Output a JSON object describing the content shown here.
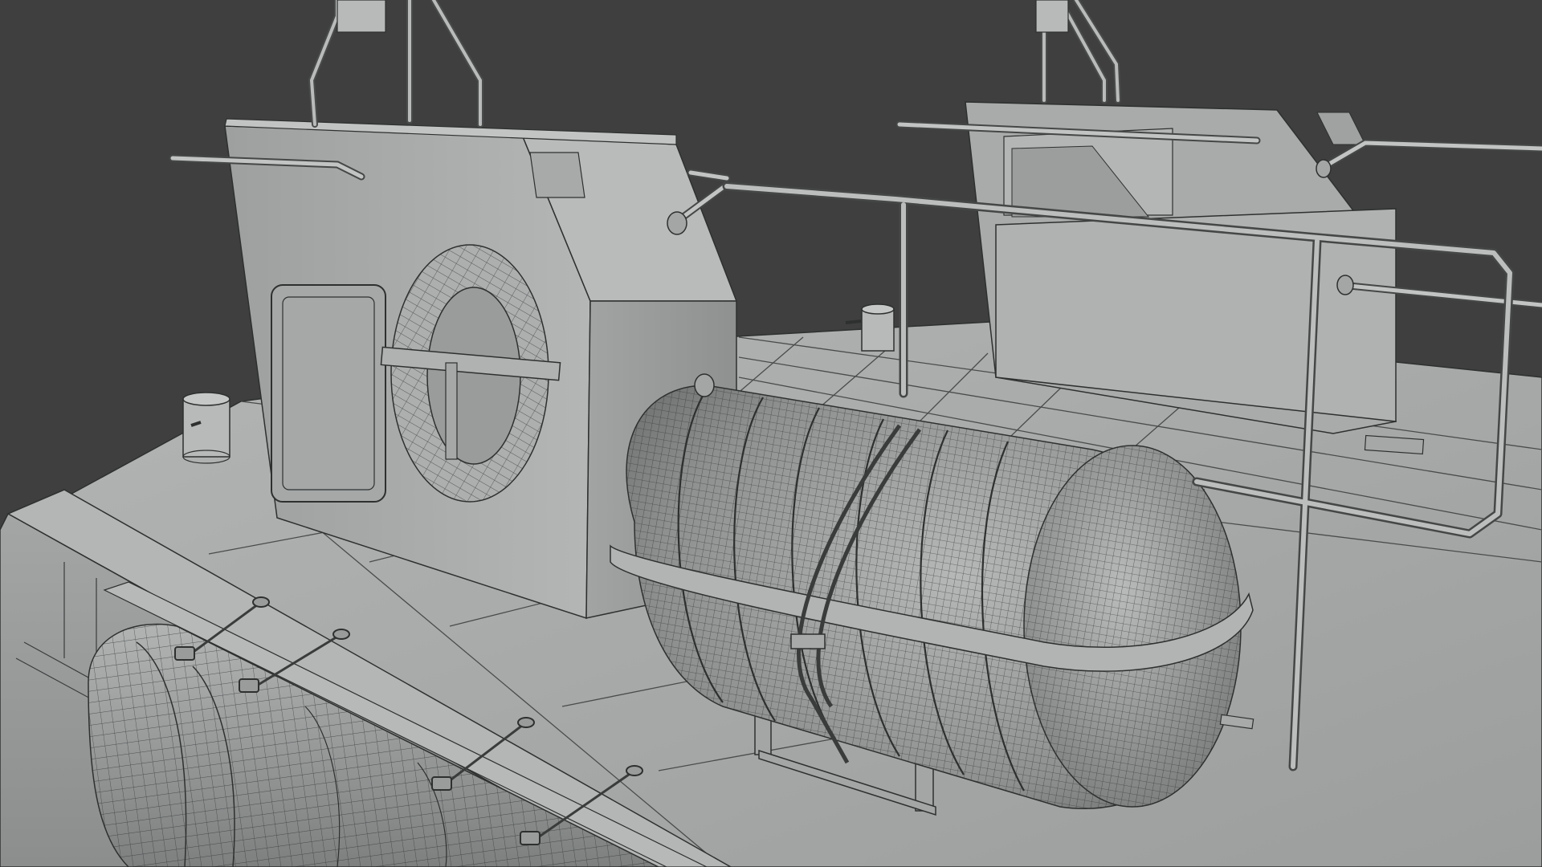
{
  "viewport": {
    "background_color": "#3f3f3f",
    "mesh_base_color": "#a9abab",
    "mesh_light_color": "#c4c6c6",
    "mesh_dark_color": "#7d8080",
    "wire_color": "#2e3030",
    "axis_line_color": "#d04848"
  }
}
